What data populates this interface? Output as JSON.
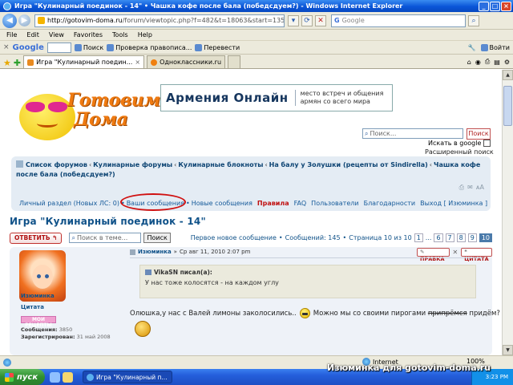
{
  "window": {
    "title": "Игра \"Кулинарный поединок - 14\" • Чашка кофе после бала (победсдуем?) - Windows Internet Explorer"
  },
  "address_bar": {
    "url_host": "http://gotovim-doma.ru",
    "url_path": "/forum/viewtopic.php?f=482&t=18063&start=135",
    "search_placeholder": "Google"
  },
  "menu": [
    "File",
    "Edit",
    "View",
    "Favorites",
    "Tools",
    "Help"
  ],
  "google_toolbar": {
    "logo": "Google",
    "search_label": "Поиск",
    "spell_label": "Проверка правописа...",
    "translate_label": "Перевести",
    "signin_label": "Войти"
  },
  "tabs": [
    {
      "label": "Игра \"Кулинарный поедин...",
      "active": true
    },
    {
      "label": "Одноклассники.ru",
      "active": false
    }
  ],
  "site": {
    "logo_line1": "Готовим",
    "logo_line2": "Дома",
    "banner_big": "Армения Онлайн",
    "banner_small_1": "место встреч и общения",
    "banner_small_2": "армян со всего мира",
    "search_placeholder": "Поиск...",
    "search_button": "Поиск",
    "google_check_label": "Искать в google",
    "advanced_search": "Расширенный поиск"
  },
  "breadcrumbs": [
    "Список форумов",
    "Кулинарные форумы",
    "Кулинарные блокноты",
    "На балу у Золушки (рецепты от Sindirella)",
    "Чашка кофе после бала (победсдуем?)"
  ],
  "usernav": {
    "personal": "Личный раздел (Новых ЛС: 0)",
    "your_posts": "Ваши сообщения",
    "new_posts": "Новые сообщения",
    "rules": "Правила",
    "faq": "FAQ",
    "users": "Пользователи",
    "thanks": "Благодарности",
    "logout": "Выход [ Изюминка ]"
  },
  "topic": {
    "title": "Игра \"Кулинарный поединок - 14\"",
    "reply_button": "ОТВЕТИТЬ",
    "search_placeholder": "Поиск в теме...",
    "search_button": "Поиск",
    "first_new": "Первое новое сообщение",
    "post_count": "Сообщений: 145",
    "page_info": "Страница 10 из 10",
    "pages": [
      "1",
      "...",
      "6",
      "7",
      "8",
      "9",
      "10"
    ]
  },
  "post": {
    "author": "Изюминка",
    "date": "Ср авг 11, 2010 2:07 pm",
    "edit_button": "ПРАВКА",
    "quote_button": "ЦИТАТА",
    "user_quote_label": "Цитата",
    "badge": "МОИ РЕЦЕПТЫ",
    "messages_label": "Сообщения:",
    "messages_value": "3850",
    "registered_label": "Зарегистрирован:",
    "registered_value": "31 май 2008",
    "quote_header": "VikaSN писал(а):",
    "quote_text": "У нас тоже колосятся - на каждом углу",
    "text_1": "Олюшка,у нас с Валей лимоны заколосились..",
    "text_2": "Можно мы со своими пирогами",
    "text_struck": "припрёмся",
    "text_3": "придём?"
  },
  "statusbar": {
    "zone": "Internet",
    "zoom": "100%"
  },
  "taskbar": {
    "start": "пуск",
    "task": "Игра \"Кулинарный п...",
    "clock": "3:23 PM"
  },
  "watermark": "Изюминка для gotovim-doma.ru"
}
